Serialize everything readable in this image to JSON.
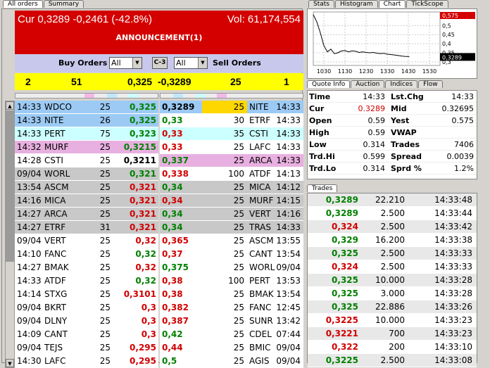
{
  "left_tabs": [
    {
      "label": "All orders",
      "active": true
    },
    {
      "label": "Summary",
      "active": false
    }
  ],
  "right_tabs_top": [
    {
      "label": "Stats",
      "active": false
    },
    {
      "label": "Histogram",
      "active": false
    },
    {
      "label": "Chart",
      "active": true
    },
    {
      "label": "TickScope",
      "active": false
    }
  ],
  "right_tabs_mid": [
    {
      "label": "Quote Info",
      "active": true
    },
    {
      "label": "Auction",
      "active": false
    },
    {
      "label": "Indices",
      "active": false
    },
    {
      "label": "Flow",
      "active": false
    }
  ],
  "right_tabs_trades": [
    {
      "label": "Trades",
      "active": true
    }
  ],
  "header": {
    "cur": "Cur 0,3289 -0,2461 (-42.8%)",
    "vol": "Vol: 61,174,554",
    "announcement": "ANNOUNCEMENT(1)"
  },
  "filter": {
    "buy_label": "Buy Orders",
    "buy_select": "All",
    "link_label": "C-3",
    "sell_select": "All",
    "sell_label": "Sell Orders"
  },
  "summary": {
    "buy_count": "2",
    "buy_qty": "51",
    "buy_price": "0,325",
    "sell_price": "-0,3289",
    "sell_qty": "25",
    "sell_count": "1"
  },
  "colors": {
    "red_bar": "#d40000",
    "filter_bg": "#c8c8ec",
    "summary_bg": "#ffff00",
    "row_blue": "#9ccaf4",
    "row_cyan": "#ccffff",
    "row_pink": "#e8b0e0",
    "row_gray": "#c8c8c8",
    "row_white": "#ffffff",
    "highlight_yellow": "#ffd700",
    "price_green": "#008000",
    "price_red": "#d00000"
  },
  "buy_orders": [
    {
      "time": "14:33",
      "mm": "WDCO",
      "size": "25",
      "price": "0,325",
      "color": "green",
      "bg": "blue"
    },
    {
      "time": "14:33",
      "mm": "NITE",
      "size": "26",
      "price": "0,325",
      "color": "green",
      "bg": "blue"
    },
    {
      "time": "14:33",
      "mm": "PERT",
      "size": "75",
      "price": "0,323",
      "color": "green",
      "bg": "cyan"
    },
    {
      "time": "14:32",
      "mm": "MURF",
      "size": "25",
      "price": "0,3215",
      "color": "green",
      "bg": "pink"
    },
    {
      "time": "14:28",
      "mm": "CSTI",
      "size": "25",
      "price": "0,3211",
      "color": "black",
      "bg": "white"
    },
    {
      "time": "09/04",
      "mm": "WORL",
      "size": "25",
      "price": "0,321",
      "color": "green",
      "bg": "gray"
    },
    {
      "time": "13:54",
      "mm": "ASCM",
      "size": "25",
      "price": "0,321",
      "color": "red",
      "bg": "gray"
    },
    {
      "time": "14:16",
      "mm": "MICA",
      "size": "25",
      "price": "0,321",
      "color": "red",
      "bg": "gray"
    },
    {
      "time": "14:27",
      "mm": "ARCA",
      "size": "25",
      "price": "0,321",
      "color": "red",
      "bg": "gray"
    },
    {
      "time": "14:27",
      "mm": "ETRF",
      "size": "31",
      "price": "0,321",
      "color": "red",
      "bg": "gray"
    },
    {
      "time": "09/04",
      "mm": "VERT",
      "size": "25",
      "price": "0,32",
      "color": "red",
      "bg": "white"
    },
    {
      "time": "14:10",
      "mm": "FANC",
      "size": "25",
      "price": "0,32",
      "color": "green",
      "bg": "white"
    },
    {
      "time": "14:27",
      "mm": "BMAK",
      "size": "25",
      "price": "0,32",
      "color": "red",
      "bg": "white"
    },
    {
      "time": "14:33",
      "mm": "ATDF",
      "size": "25",
      "price": "0,32",
      "color": "green",
      "bg": "white"
    },
    {
      "time": "14:14",
      "mm": "STXG",
      "size": "25",
      "price": "0,3101",
      "color": "red",
      "bg": "white"
    },
    {
      "time": "09/04",
      "mm": "BKRT",
      "size": "25",
      "price": "0,3",
      "color": "red",
      "bg": "white"
    },
    {
      "time": "09/04",
      "mm": "DLNY",
      "size": "25",
      "price": "0,3",
      "color": "red",
      "bg": "white"
    },
    {
      "time": "14:09",
      "mm": "CANT",
      "size": "25",
      "price": "0,3",
      "color": "red",
      "bg": "white"
    },
    {
      "time": "09/04",
      "mm": "TEJS",
      "size": "25",
      "price": "0,295",
      "color": "red",
      "bg": "white"
    },
    {
      "time": "14:30",
      "mm": "LAFC",
      "size": "25",
      "price": "0,295",
      "color": "red",
      "bg": "white"
    }
  ],
  "sell_orders": [
    {
      "price": "0,3289",
      "size": "25",
      "mm": "NITE",
      "time": "14:33",
      "color": "black",
      "bg": "blue"
    },
    {
      "price": "0,33",
      "size": "30",
      "mm": "ETRF",
      "time": "14:33",
      "color": "green",
      "bg": "white"
    },
    {
      "price": "0,33",
      "size": "35",
      "mm": "CSTI",
      "time": "14:33",
      "color": "red",
      "bg": "cyan"
    },
    {
      "price": "0,33",
      "size": "25",
      "mm": "LAFC",
      "time": "14:33",
      "color": "red",
      "bg": "white"
    },
    {
      "price": "0,337",
      "size": "25",
      "mm": "ARCA",
      "time": "14:33",
      "color": "green",
      "bg": "pink"
    },
    {
      "price": "0,338",
      "size": "100",
      "mm": "ATDF",
      "time": "14:13",
      "color": "red",
      "bg": "white"
    },
    {
      "price": "0,34",
      "size": "25",
      "mm": "MICA",
      "time": "14:12",
      "color": "green",
      "bg": "gray"
    },
    {
      "price": "0,34",
      "size": "25",
      "mm": "MURF",
      "time": "14:15",
      "color": "red",
      "bg": "gray"
    },
    {
      "price": "0,34",
      "size": "25",
      "mm": "VERT",
      "time": "14:16",
      "color": "green",
      "bg": "gray"
    },
    {
      "price": "0,34",
      "size": "25",
      "mm": "TRAS",
      "time": "14:33",
      "color": "green",
      "bg": "gray"
    },
    {
      "price": "0,365",
      "size": "25",
      "mm": "ASCM",
      "time": "13:55",
      "color": "red",
      "bg": "white"
    },
    {
      "price": "0,37",
      "size": "25",
      "mm": "CANT",
      "time": "13:54",
      "color": "red",
      "bg": "white"
    },
    {
      "price": "0,375",
      "size": "25",
      "mm": "WORL",
      "time": "09/04",
      "color": "green",
      "bg": "white"
    },
    {
      "price": "0,38",
      "size": "100",
      "mm": "PERT",
      "time": "13:53",
      "color": "red",
      "bg": "white"
    },
    {
      "price": "0,38",
      "size": "25",
      "mm": "BMAK",
      "time": "13:54",
      "color": "red",
      "bg": "white"
    },
    {
      "price": "0,382",
      "size": "25",
      "mm": "FANC",
      "time": "12:45",
      "color": "red",
      "bg": "white"
    },
    {
      "price": "0,387",
      "size": "25",
      "mm": "SUNR",
      "time": "13:42",
      "color": "red",
      "bg": "white"
    },
    {
      "price": "0,42",
      "size": "25",
      "mm": "CDEL",
      "time": "07:44",
      "color": "green",
      "bg": "white"
    },
    {
      "price": "0,44",
      "size": "25",
      "mm": "BMIC",
      "time": "09/04",
      "color": "red",
      "bg": "white"
    },
    {
      "price": "0,5",
      "size": "25",
      "mm": "AGIS",
      "time": "09/04",
      "color": "green",
      "bg": "white"
    }
  ],
  "chart_data": {
    "type": "line",
    "x_ticks": [
      "1030",
      "1130",
      "1230",
      "1330",
      "1430",
      "1530"
    ],
    "y_ticks": [
      "0,5",
      "0,45",
      "0,4",
      "0,35",
      "0,3"
    ],
    "price_high_label": "0,575",
    "price_current_label": "0,3289",
    "xlim": [
      1000,
      1600
    ],
    "ylim": [
      0.28,
      0.575
    ],
    "x": [
      1000,
      1010,
      1020,
      1030,
      1040,
      1050,
      1100,
      1110,
      1120,
      1130,
      1140,
      1150,
      1200,
      1210,
      1220,
      1230,
      1240,
      1250,
      1300,
      1310,
      1320,
      1330,
      1340,
      1350,
      1400,
      1410,
      1420,
      1430,
      1433
    ],
    "y": [
      0.56,
      0.52,
      0.46,
      0.39,
      0.355,
      0.37,
      0.345,
      0.35,
      0.36,
      0.362,
      0.355,
      0.36,
      0.358,
      0.352,
      0.355,
      0.352,
      0.35,
      0.352,
      0.348,
      0.345,
      0.347,
      0.342,
      0.34,
      0.338,
      0.335,
      0.332,
      0.33,
      0.329,
      0.3289
    ]
  },
  "quote": {
    "rows": [
      {
        "l1": "Time",
        "v1": "14:33",
        "l2": "Lst.Chg",
        "v2": "14:33",
        "c1": "black",
        "bg": "white"
      },
      {
        "l1": "Cur",
        "v1": "0.3289",
        "l2": "Mid",
        "v2": "0.32695",
        "c1": "red",
        "bg": "white"
      },
      {
        "l1": "Open",
        "v1": "0.59",
        "l2": "Yest",
        "v2": "0.575",
        "c1": "black",
        "bg": "white"
      },
      {
        "l1": "High",
        "v1": "0.59",
        "l2": "VWAP",
        "v2": "",
        "c1": "black",
        "bg": "white"
      },
      {
        "l1": "Low",
        "v1": "0.314",
        "l2": "Trades",
        "v2": "7406",
        "c1": "black",
        "bg": "white"
      },
      {
        "l1": "Trd.Hi",
        "v1": "0.599",
        "l2": "Spread",
        "v2": "0.0039",
        "c1": "black",
        "bg": "white"
      },
      {
        "l1": "Trd.Lo",
        "v1": "0.314",
        "l2": "Sprd %",
        "v2": "1.2%",
        "c1": "black",
        "bg": "white"
      }
    ]
  },
  "trades": [
    {
      "price": "0,3289",
      "size": "22.210",
      "time": "14:33:48",
      "color": "green"
    },
    {
      "price": "0,3289",
      "size": "2.500",
      "time": "14:33:44",
      "color": "green"
    },
    {
      "price": "0,324",
      "size": "2.500",
      "time": "14:33:42",
      "color": "red"
    },
    {
      "price": "0,329",
      "size": "16.200",
      "time": "14:33:38",
      "color": "green"
    },
    {
      "price": "0,325",
      "size": "2.500",
      "time": "14:33:33",
      "color": "green"
    },
    {
      "price": "0,324",
      "size": "2.500",
      "time": "14:33:33",
      "color": "red"
    },
    {
      "price": "0,325",
      "size": "10.000",
      "time": "14:33:28",
      "color": "green"
    },
    {
      "price": "0,325",
      "size": "3.000",
      "time": "14:33:28",
      "color": "green"
    },
    {
      "price": "0,325",
      "size": "22.886",
      "time": "14:33:26",
      "color": "green"
    },
    {
      "price": "0,3225",
      "size": "10.000",
      "time": "14:33:23",
      "color": "red"
    },
    {
      "price": "0,3221",
      "size": "700",
      "time": "14:33:23",
      "color": "red"
    },
    {
      "price": "0,322",
      "size": "200",
      "time": "14:33:10",
      "color": "red"
    },
    {
      "price": "0,3225",
      "size": "2.500",
      "time": "14:33:08",
      "color": "green"
    }
  ]
}
